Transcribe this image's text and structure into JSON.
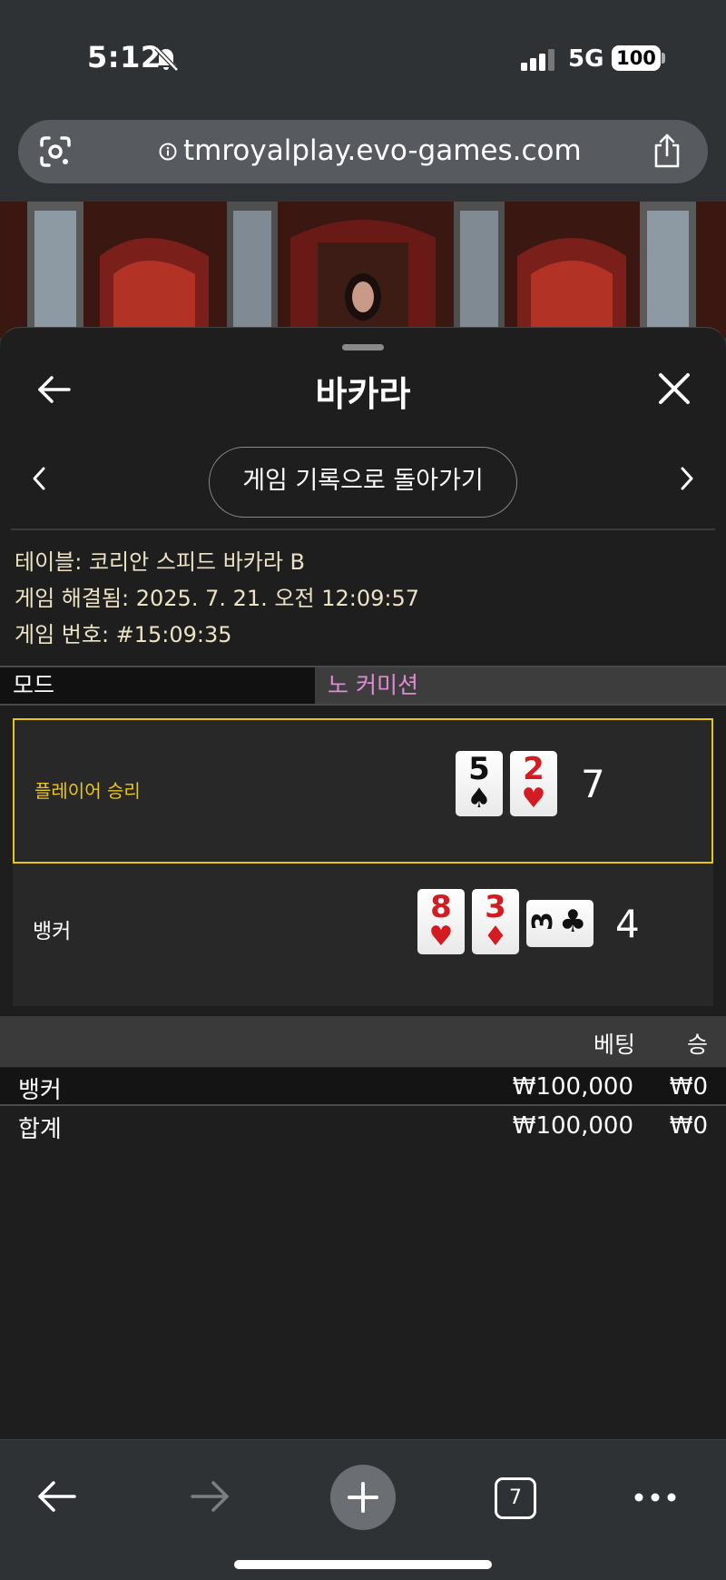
{
  "status_bar": {
    "time": "5:12",
    "network": "5G",
    "battery": "100"
  },
  "browser": {
    "url": "tmroyalplay.evo-games.com",
    "tab_count": "7"
  },
  "sheet": {
    "title": "바카라",
    "back_history_button": "게임 기록으로 돌아가기",
    "info": {
      "table": "테이블: 코리안 스피드 바카라 B",
      "resolved": "게임 해결됨: 2025. 7. 21. 오전 12:09:57",
      "game_number": "게임 번호: #15:09:35"
    },
    "mode": {
      "label": "모드",
      "value": "노 커미션"
    }
  },
  "result": {
    "player": {
      "label": "플레이어 승리",
      "total": "7",
      "cards": [
        {
          "rank": "5",
          "suit": "♠"
        },
        {
          "rank": "2",
          "suit": "♥"
        }
      ]
    },
    "banker": {
      "label": "뱅커",
      "total": "4",
      "cards": [
        {
          "rank": "8",
          "suit": "♥"
        },
        {
          "rank": "3",
          "suit": "♦"
        },
        {
          "rank": "3",
          "suit": "♣"
        }
      ]
    }
  },
  "bets": {
    "headers": {
      "bet": "베팅",
      "win": "승"
    },
    "rows": [
      {
        "name": "뱅커",
        "bet": "₩100,000",
        "win": "₩0"
      },
      {
        "name": "합계",
        "bet": "₩100,000",
        "win": "₩0"
      }
    ]
  },
  "colors": {
    "win_highlight": "#e8c619",
    "mode_value": "#e08ad6",
    "sheet_bg": "#1e1e1e"
  }
}
